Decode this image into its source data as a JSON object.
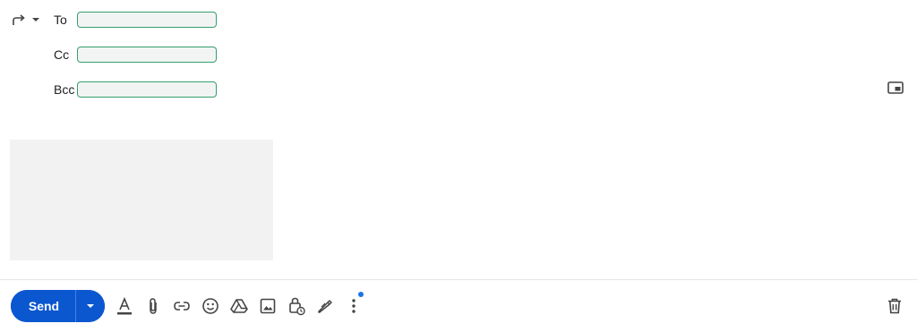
{
  "recipients": {
    "to_label": "To",
    "cc_label": "Cc",
    "bcc_label": "Bcc",
    "to_value": "",
    "cc_value": "",
    "bcc_value": ""
  },
  "reply_type": {
    "icon": "reply-forward-icon",
    "menu_icon": "caret-down-icon"
  },
  "toolbar": {
    "send_label": "Send",
    "send_more_icon": "caret-down-icon",
    "tools": [
      "text-formatting-icon",
      "attach-icon",
      "link-icon",
      "emoji-icon",
      "drive-icon",
      "photo-icon",
      "confidential-mode-icon",
      "signature-icon",
      "more-options-icon"
    ],
    "discard_icon": "trash-icon"
  },
  "colors": {
    "send_button": "#0b57d0",
    "input_border": "#33a06e",
    "notification_dot": "#1a73e8"
  }
}
